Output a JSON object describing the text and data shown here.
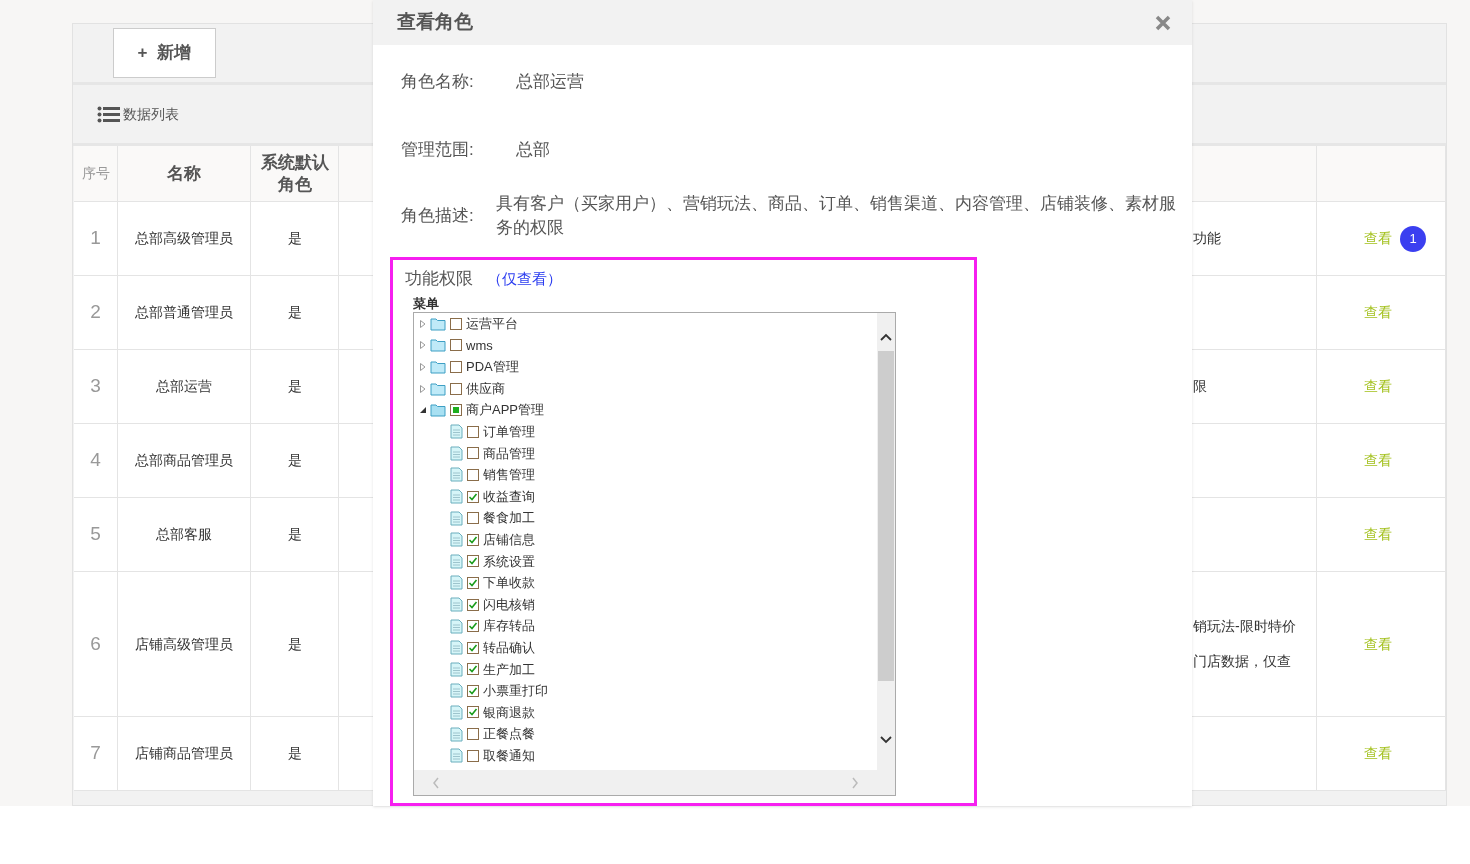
{
  "toolbar": {
    "add_button": {
      "icon": "+",
      "label": "新增"
    }
  },
  "list_header": {
    "title": "数据列表"
  },
  "table": {
    "columns": [
      "序号",
      "名称",
      "系统默认角色"
    ],
    "rows": [
      {
        "index": "1",
        "name": "总部高级管理员",
        "default": "是",
        "column_5": [
          "功能"
        ],
        "action": "查看",
        "badge": "1"
      },
      {
        "index": "2",
        "name": "总部普通管理员",
        "default": "是",
        "action": "查看"
      },
      {
        "index": "3",
        "name": "总部运营",
        "default": "是",
        "column_5": [
          "限"
        ],
        "action": "查看"
      },
      {
        "index": "4",
        "name": "总部商品管理员",
        "default": "是",
        "action": "查看"
      },
      {
        "index": "5",
        "name": "总部客服",
        "default": "是",
        "action": "查看"
      },
      {
        "index": "6",
        "name": "店铺高级管理员",
        "default": "是",
        "column_5": [
          "销玩法-限时特价",
          "门店数据，仅查"
        ],
        "action": "查看"
      },
      {
        "index": "7",
        "name": "店铺商品管理员",
        "default": "是",
        "action": "查看"
      }
    ]
  },
  "modal": {
    "title": "查看角色",
    "fields": [
      {
        "label": "角色名称:",
        "value": "总部运营"
      },
      {
        "label": "管理范围:",
        "value": "总部"
      },
      {
        "label": "角色描述:",
        "value": "具有客户（买家用户）、营销玩法、商品、订单、销售渠道、内容管理、店铺装修、素材服务的权限"
      }
    ],
    "permissions": {
      "title": "功能权限",
      "note": "（仅查看）",
      "tree_label": "菜单",
      "highlighted": true,
      "tree": [
        {
          "label": "运营平台",
          "checked": false,
          "partial": false,
          "expanded": false
        },
        {
          "label": "wms",
          "checked": false,
          "partial": false,
          "expanded": false
        },
        {
          "label": "PDA管理",
          "checked": false,
          "partial": false,
          "expanded": false
        },
        {
          "label": "供应商",
          "checked": false,
          "partial": false,
          "expanded": false
        },
        {
          "label": "商户APP管理",
          "checked": false,
          "partial": true,
          "expanded": true,
          "children": [
            {
              "label": "订单管理",
              "checked": false
            },
            {
              "label": "商品管理",
              "checked": false
            },
            {
              "label": "销售管理",
              "checked": false
            },
            {
              "label": "收益查询",
              "checked": true
            },
            {
              "label": "餐食加工",
              "checked": false
            },
            {
              "label": "店铺信息",
              "checked": true
            },
            {
              "label": "系统设置",
              "checked": true
            },
            {
              "label": "下单收款",
              "checked": true
            },
            {
              "label": "闪电核销",
              "checked": true
            },
            {
              "label": "库存转品",
              "checked": true
            },
            {
              "label": "转品确认",
              "checked": true
            },
            {
              "label": "生产加工",
              "checked": true
            },
            {
              "label": "小票重打印",
              "checked": true
            },
            {
              "label": "银商退款",
              "checked": true
            },
            {
              "label": "正餐点餐",
              "checked": false
            },
            {
              "label": "取餐通知",
              "checked": false
            }
          ]
        }
      ]
    }
  }
}
